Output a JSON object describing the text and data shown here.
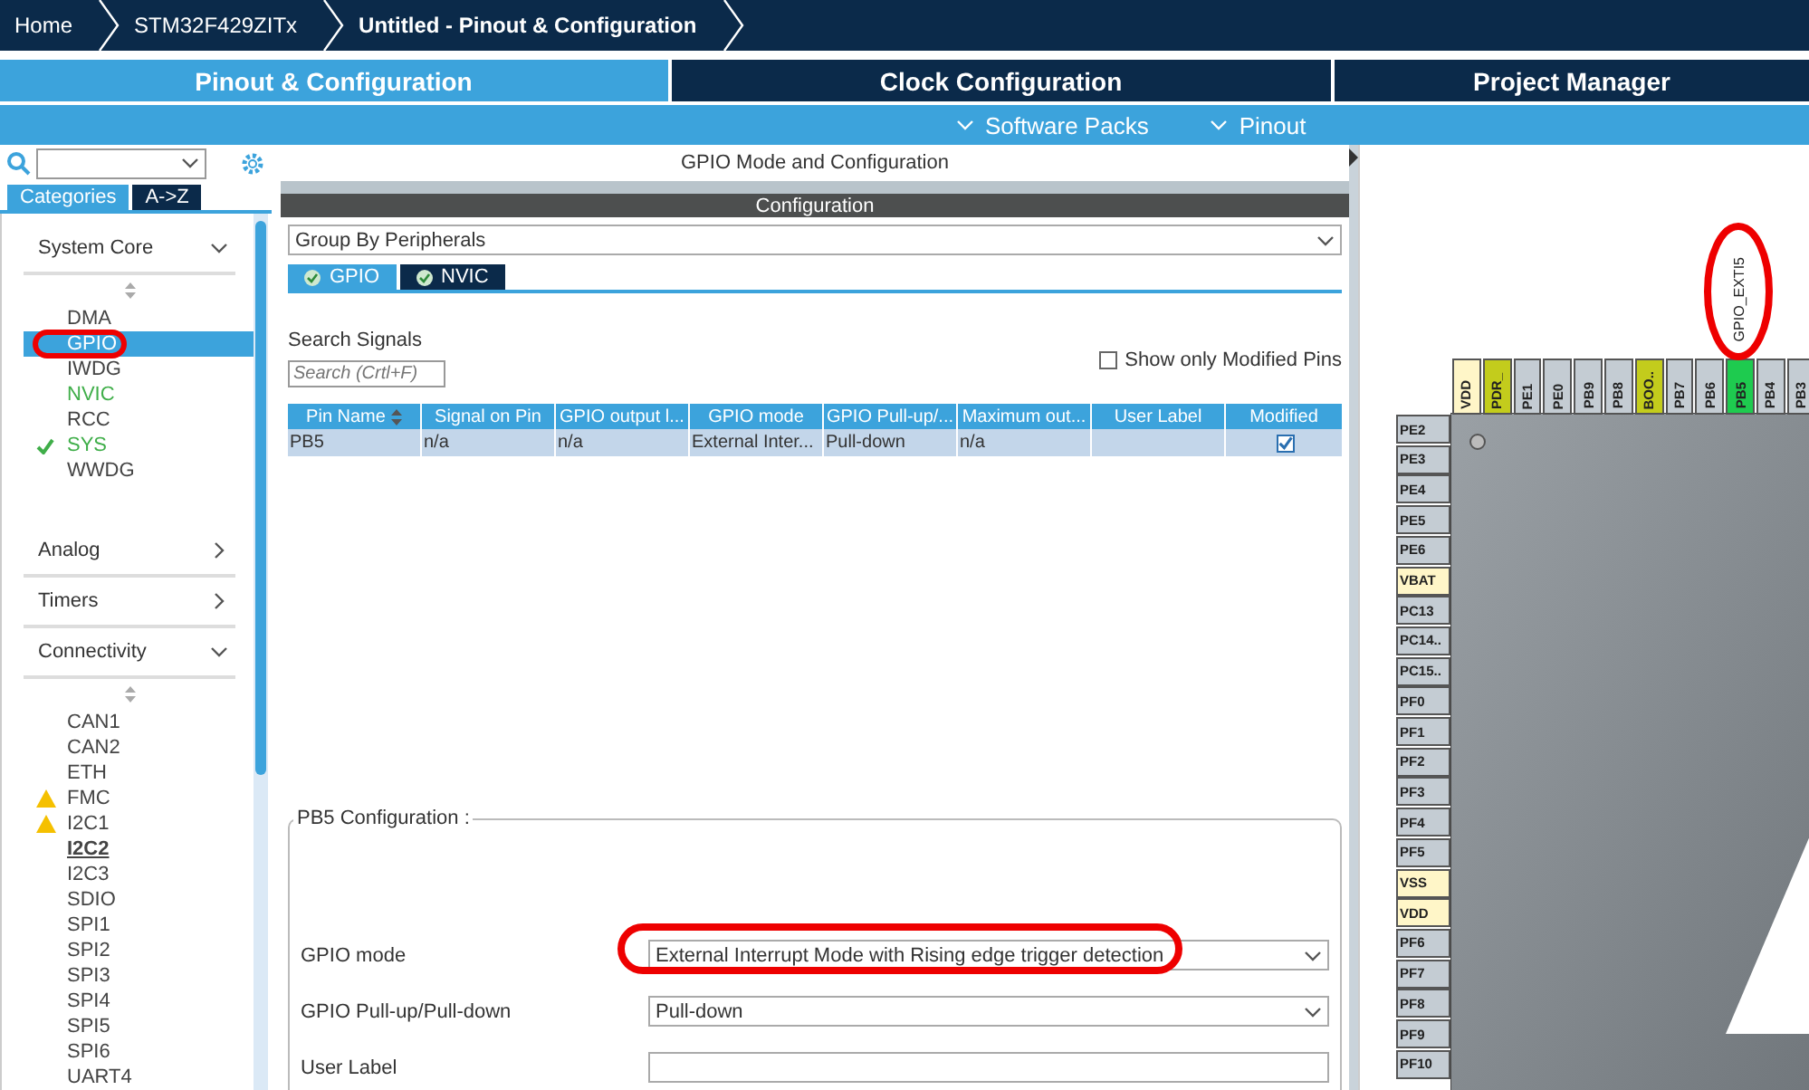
{
  "breadcrumb": [
    {
      "label": "Home",
      "current": false
    },
    {
      "label": "STM32F429ZITx",
      "current": false
    },
    {
      "label": "Untitled - Pinout & Configuration",
      "current": true
    }
  ],
  "main_tabs": [
    {
      "label": "Pinout & Configuration",
      "selected": true
    },
    {
      "label": "Clock Configuration",
      "selected": false
    },
    {
      "label": "Project Manager",
      "selected": false
    }
  ],
  "sub_menu": [
    "Software Packs",
    "Pinout"
  ],
  "sidebar": {
    "view_tabs": [
      {
        "label": "Categories",
        "selected": true
      },
      {
        "label": "A->Z",
        "selected": false
      }
    ],
    "groups": [
      {
        "title": "System Core",
        "expanded": true,
        "items": [
          {
            "label": "DMA",
            "selected": false,
            "enabled": false,
            "checked": false,
            "warning": false,
            "hovered": false
          },
          {
            "label": "GPIO",
            "selected": true,
            "enabled": false,
            "checked": false,
            "warning": false,
            "hovered": false
          },
          {
            "label": "IWDG",
            "selected": false,
            "enabled": false,
            "checked": false,
            "warning": false,
            "hovered": false
          },
          {
            "label": "NVIC",
            "selected": false,
            "enabled": true,
            "checked": false,
            "warning": false,
            "hovered": false
          },
          {
            "label": "RCC",
            "selected": false,
            "enabled": false,
            "checked": false,
            "warning": false,
            "hovered": false
          },
          {
            "label": "SYS",
            "selected": false,
            "enabled": true,
            "checked": true,
            "warning": false,
            "hovered": false
          },
          {
            "label": "WWDG",
            "selected": false,
            "enabled": false,
            "checked": false,
            "warning": false,
            "hovered": false
          }
        ]
      },
      {
        "title": "Analog",
        "expanded": false
      },
      {
        "title": "Timers",
        "expanded": false
      },
      {
        "title": "Connectivity",
        "expanded": true,
        "items": [
          {
            "label": "CAN1",
            "selected": false,
            "enabled": false,
            "checked": false,
            "warning": false,
            "hovered": false
          },
          {
            "label": "CAN2",
            "selected": false,
            "enabled": false,
            "checked": false,
            "warning": false,
            "hovered": false
          },
          {
            "label": "ETH",
            "selected": false,
            "enabled": false,
            "checked": false,
            "warning": false,
            "hovered": false
          },
          {
            "label": "FMC",
            "selected": false,
            "enabled": false,
            "checked": false,
            "warning": true,
            "hovered": false
          },
          {
            "label": "I2C1",
            "selected": false,
            "enabled": false,
            "checked": false,
            "warning": true,
            "hovered": false
          },
          {
            "label": "I2C2",
            "selected": false,
            "enabled": false,
            "checked": false,
            "warning": false,
            "hovered": true
          },
          {
            "label": "I2C3",
            "selected": false,
            "enabled": false,
            "checked": false,
            "warning": false,
            "hovered": false
          },
          {
            "label": "SDIO",
            "selected": false,
            "enabled": false,
            "checked": false,
            "warning": false,
            "hovered": false
          },
          {
            "label": "SPI1",
            "selected": false,
            "enabled": false,
            "checked": false,
            "warning": false,
            "hovered": false
          },
          {
            "label": "SPI2",
            "selected": false,
            "enabled": false,
            "checked": false,
            "warning": false,
            "hovered": false
          },
          {
            "label": "SPI3",
            "selected": false,
            "enabled": false,
            "checked": false,
            "warning": false,
            "hovered": false
          },
          {
            "label": "SPI4",
            "selected": false,
            "enabled": false,
            "checked": false,
            "warning": false,
            "hovered": false
          },
          {
            "label": "SPI5",
            "selected": false,
            "enabled": false,
            "checked": false,
            "warning": false,
            "hovered": false
          },
          {
            "label": "SPI6",
            "selected": false,
            "enabled": false,
            "checked": false,
            "warning": false,
            "hovered": false
          },
          {
            "label": "UART4",
            "selected": false,
            "enabled": false,
            "checked": false,
            "warning": false,
            "hovered": false
          }
        ]
      }
    ]
  },
  "config": {
    "title": "GPIO Mode and Configuration",
    "section": "Configuration",
    "group_by": "Group By Peripherals",
    "tabs": [
      {
        "label": "GPIO",
        "selected": true
      },
      {
        "label": "NVIC",
        "selected": false
      }
    ],
    "search_label": "Search Signals",
    "search_placeholder": "Search (Crtl+F)",
    "modified_only": {
      "label": "Show only Modified Pins",
      "checked": false
    },
    "table": {
      "columns": [
        "Pin Name",
        "Signal on Pin",
        "GPIO output l...",
        "GPIO mode",
        "GPIO Pull-up/...",
        "Maximum out...",
        "User Label",
        "Modified"
      ],
      "rows": [
        {
          "selected": true,
          "modified": true,
          "cells": [
            "PB5",
            "n/a",
            "n/a",
            "External Inter...",
            "Pull-down",
            "n/a"
          ]
        }
      ]
    },
    "pin_config": {
      "title": "PB5 Configuration :",
      "fields": [
        {
          "kind": "select",
          "label": "GPIO mode",
          "value": "External Interrupt Mode with Rising edge trigger detection"
        },
        {
          "kind": "select",
          "label": "GPIO Pull-up/Pull-down",
          "value": "Pull-down"
        },
        {
          "kind": "text",
          "label": "User Label"
        }
      ]
    }
  },
  "chip": {
    "top_pins": [
      {
        "label": "VDD",
        "kind": "power"
      },
      {
        "label": "PDR_",
        "kind": "special"
      },
      {
        "label": "PE1",
        "kind": "io"
      },
      {
        "label": "PE0",
        "kind": "io"
      },
      {
        "label": "PB9",
        "kind": "io"
      },
      {
        "label": "PB8",
        "kind": "io"
      },
      {
        "label": "BOO..",
        "kind": "special"
      },
      {
        "label": "PB7",
        "kind": "io"
      },
      {
        "label": "PB6",
        "kind": "io"
      },
      {
        "label": "PB5",
        "kind": "assigned",
        "signal": "GPIO_EXTI5"
      },
      {
        "label": "PB4",
        "kind": "io"
      },
      {
        "label": "PB3",
        "kind": "io"
      }
    ],
    "left_pins": [
      {
        "label": "PE2",
        "kind": "io"
      },
      {
        "label": "PE3",
        "kind": "io"
      },
      {
        "label": "PE4",
        "kind": "io"
      },
      {
        "label": "PE5",
        "kind": "io"
      },
      {
        "label": "PE6",
        "kind": "io"
      },
      {
        "label": "VBAT",
        "kind": "power"
      },
      {
        "label": "PC13",
        "kind": "io"
      },
      {
        "label": "PC14..",
        "kind": "io"
      },
      {
        "label": "PC15..",
        "kind": "io"
      },
      {
        "label": "PF0",
        "kind": "io"
      },
      {
        "label": "PF1",
        "kind": "io"
      },
      {
        "label": "PF2",
        "kind": "io"
      },
      {
        "label": "PF3",
        "kind": "io"
      },
      {
        "label": "PF4",
        "kind": "io"
      },
      {
        "label": "PF5",
        "kind": "io"
      },
      {
        "label": "VSS",
        "kind": "power"
      },
      {
        "label": "VDD",
        "kind": "power"
      },
      {
        "label": "PF6",
        "kind": "io"
      },
      {
        "label": "PF7",
        "kind": "io"
      },
      {
        "label": "PF8",
        "kind": "io"
      },
      {
        "label": "PF9",
        "kind": "io"
      },
      {
        "label": "PF10",
        "kind": "io"
      }
    ]
  }
}
